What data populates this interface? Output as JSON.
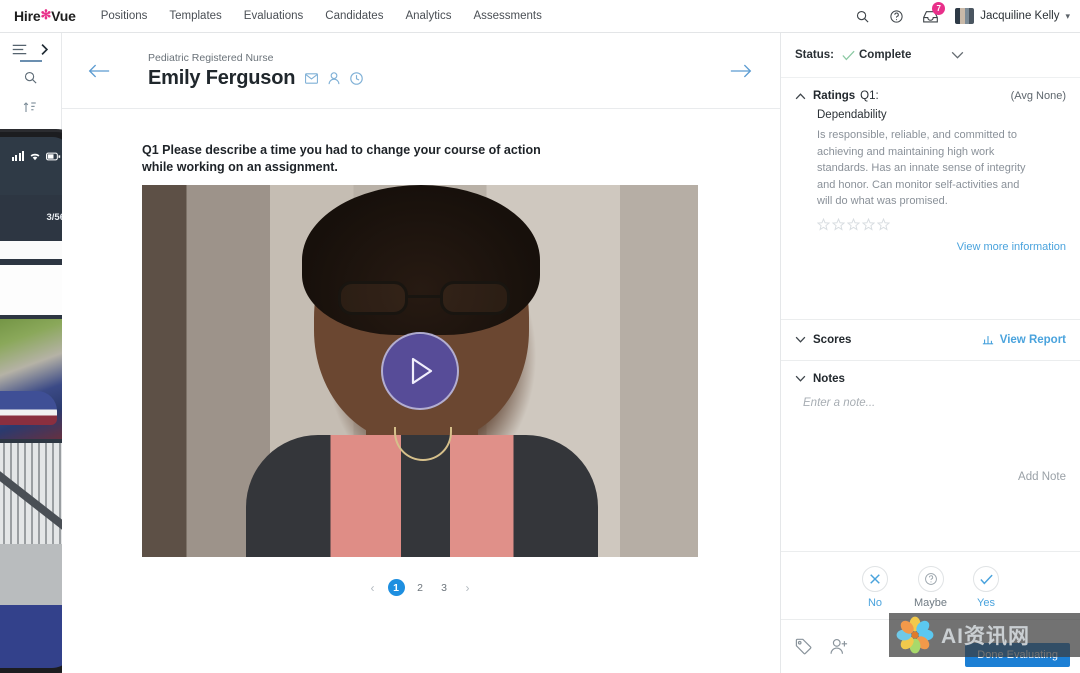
{
  "topnav": {
    "logo": {
      "pre": "Hire",
      "star": "✻",
      "post": "Vue",
      "star_color": "#e8308a"
    },
    "items": [
      {
        "label": "Positions"
      },
      {
        "label": "Templates"
      },
      {
        "label": "Evaluations"
      },
      {
        "label": "Candidates"
      },
      {
        "label": "Analytics"
      },
      {
        "label": "Assessments"
      }
    ],
    "search_icon": "search-icon",
    "help_icon": "help-circle-icon",
    "notifications_icon": "inbox-icon",
    "notifications_count": "7",
    "user_name": "Jacquiline Kelly"
  },
  "rail": {
    "list_icon": "list-icon",
    "expand_icon": "chevron-right-icon",
    "search_icon": "search-icon",
    "filter_icon": "sort-filter-icon"
  },
  "phone": {
    "photo_counter": "3/56"
  },
  "candidate": {
    "role": "Pediatric Registered Nurse",
    "name": "Emily Ferguson",
    "icons": [
      "mail-icon",
      "person-icon",
      "clock-icon"
    ],
    "back": "back-arrow-icon",
    "forward": "forward-arrow-icon"
  },
  "main": {
    "question": "Q1 Please describe a time you had to change your course of action while working on an assignment.",
    "play_label": "play-icon",
    "pagination": {
      "prev": "‹",
      "pages": [
        "1",
        "2",
        "3"
      ],
      "active": "1",
      "next": "›"
    }
  },
  "panel": {
    "status_label": "Status:",
    "status_value": "Complete",
    "ratings": {
      "title": "Ratings",
      "subtitle": "Q1:",
      "average": "(Avg None)",
      "competency": "Dependability",
      "description": "Is responsible, reliable, and committed to achieving and maintaining high work standards. Has an innate sense of integrity and honor. Can monitor self-activities and will do what was promised.",
      "stars_filled": 0,
      "stars_total": 5,
      "more_link": "View more information"
    },
    "scores": {
      "title": "Scores",
      "report_link": "View Report",
      "report_icon": "bar-chart-icon"
    },
    "notes": {
      "title": "Notes",
      "placeholder": "Enter a note...",
      "value": "",
      "add_label": "Add Note"
    },
    "decisions": [
      {
        "key": "no",
        "label": "No",
        "icon": "close-icon"
      },
      {
        "key": "maybe",
        "label": "Maybe",
        "icon": "question-circle-icon"
      },
      {
        "key": "yes",
        "label": "Yes",
        "icon": "check-icon"
      }
    ],
    "footer": {
      "tag_icon": "tag-icon",
      "add_user_icon": "add-user-icon",
      "done_label": "Done Evaluating"
    }
  },
  "watermark": {
    "text": "AI资讯网"
  },
  "colors": {
    "brand_pink": "#e8308a",
    "link_blue": "#4aa3dd",
    "primary_blue": "#1c7fd4",
    "play_purple": "#544da8",
    "status_green": "#8bc9a3"
  }
}
